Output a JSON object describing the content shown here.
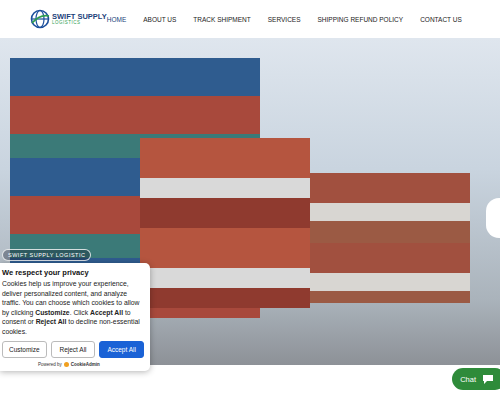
{
  "logo": {
    "name": "SWIFT SUPPLY",
    "sub": "LOGISTICS"
  },
  "nav": [
    {
      "label": "HOME",
      "selected": true
    },
    {
      "label": "ABOUT US",
      "selected": false
    },
    {
      "label": "TRACK SHIPMENT",
      "selected": false
    },
    {
      "label": "SERVICES",
      "selected": false
    },
    {
      "label": "SHIPPING REFUND POLICY",
      "selected": false
    },
    {
      "label": "CONTACT US",
      "selected": false
    }
  ],
  "hero": {
    "badge": "SWIFT SUPPLY LOGISTIC"
  },
  "cookie": {
    "title": "We respect your privacy",
    "body": [
      {
        "text": "Cookies help us improve your experience, deliver personalized content, and analyze traffic. You can choose which cookies to allow by clicking ",
        "bold": false
      },
      {
        "text": "Customize",
        "bold": true
      },
      {
        "text": ". Click ",
        "bold": false
      },
      {
        "text": "Accept All",
        "bold": true
      },
      {
        "text": " to consent or ",
        "bold": false
      },
      {
        "text": "Reject All",
        "bold": true
      },
      {
        "text": " to decline non-essential cookies.",
        "bold": false
      }
    ],
    "buttons": [
      {
        "label": "Customize",
        "primary": false
      },
      {
        "label": "Reject All",
        "primary": false
      },
      {
        "label": "Accept All",
        "primary": true
      }
    ],
    "powered": "Powered by",
    "brand": "CookieAdmin"
  },
  "chat": {
    "label": "Chat"
  }
}
